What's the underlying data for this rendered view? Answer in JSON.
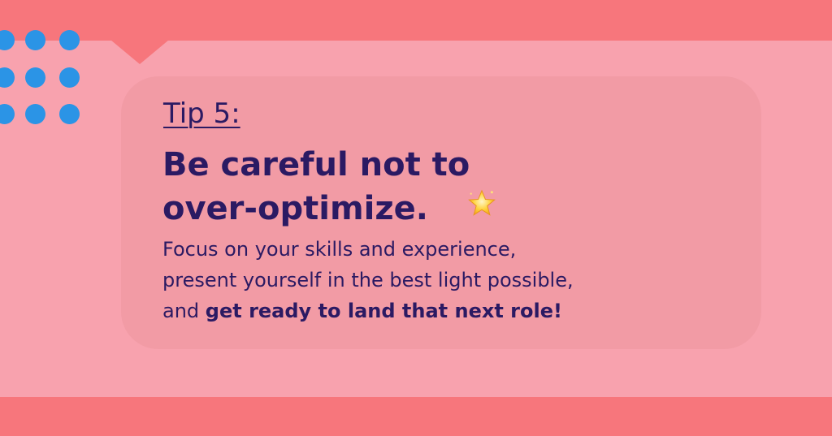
{
  "tip": {
    "label": "Tip 5:",
    "headline_line1": "Be careful not to",
    "headline_line2": "over-optimize.",
    "body_line1": "Focus on your skills and experience,",
    "body_line2": "present yourself in the best light possible,",
    "body_line3_prefix": "and ",
    "body_line3_bold": "get ready to land that next role!"
  },
  "icons": {
    "decoration": "star-emoji-icon",
    "dots": "blue-dots-pattern"
  },
  "colors": {
    "background": "#f8a2ae",
    "band": "#f7767c",
    "card": "#f29ba5",
    "text": "#2b1a63",
    "dots": "#2b94e6"
  }
}
